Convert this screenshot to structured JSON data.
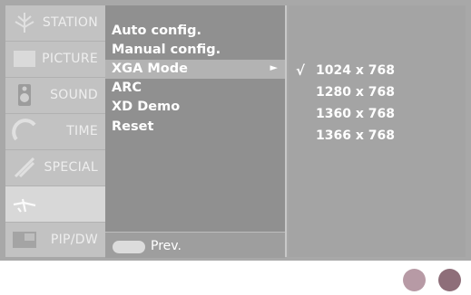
{
  "sidebar": {
    "items": [
      {
        "label": "STATION",
        "icon": "antenna-icon"
      },
      {
        "label": "PICTURE",
        "icon": "picture-icon"
      },
      {
        "label": "SOUND",
        "icon": "speaker-icon"
      },
      {
        "label": "TIME",
        "icon": "clock-icon"
      },
      {
        "label": "SPECIAL",
        "icon": "special-icon"
      },
      {
        "label": "",
        "icon": "screen-setup-icon"
      },
      {
        "label": "PIP/DW",
        "icon": "pip-icon"
      }
    ]
  },
  "menu": {
    "items": [
      {
        "label": "Auto config."
      },
      {
        "label": "Manual config."
      },
      {
        "label": "XGA Mode",
        "arrow": "►"
      },
      {
        "label": "ARC"
      },
      {
        "label": "XD Demo"
      },
      {
        "label": "Reset"
      }
    ],
    "prev_label": "Prev."
  },
  "submenu": {
    "items": [
      {
        "label": "1024 x 768",
        "check": "√"
      },
      {
        "label": "1280 x 768",
        "check": ""
      },
      {
        "label": "1360 x 768",
        "check": ""
      },
      {
        "label": "1366 x 768",
        "check": ""
      }
    ]
  },
  "colors": {
    "osd_bg": "#a8a8a8",
    "dot_left": "#b79aa5",
    "dot_right": "#8e6e79"
  }
}
